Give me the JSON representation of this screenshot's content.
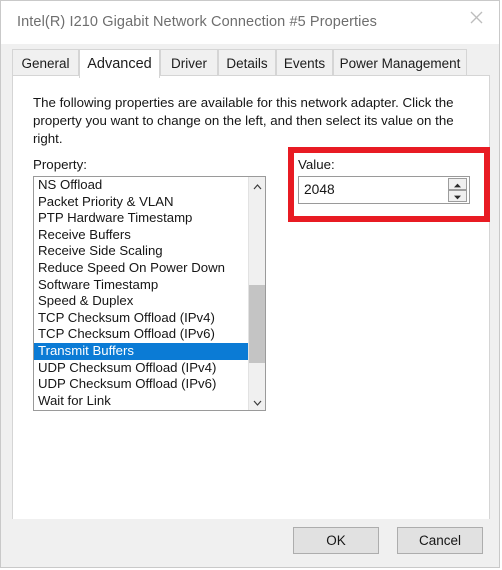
{
  "window": {
    "title": "Intel(R) I210 Gigabit Network Connection #5 Properties",
    "close_icon": "close-icon"
  },
  "tabs": [
    {
      "label": "General",
      "selected": false
    },
    {
      "label": "Advanced",
      "selected": true
    },
    {
      "label": "Driver",
      "selected": false
    },
    {
      "label": "Details",
      "selected": false
    },
    {
      "label": "Events",
      "selected": false
    },
    {
      "label": "Power Management",
      "selected": false
    }
  ],
  "advanced": {
    "description": "The following properties are available for this network adapter. Click the property you want to change on the left, and then select its value on the right.",
    "property_label": "Property:",
    "properties": [
      {
        "label": "NS Offload",
        "selected": false
      },
      {
        "label": "Packet Priority & VLAN",
        "selected": false
      },
      {
        "label": "PTP Hardware Timestamp",
        "selected": false
      },
      {
        "label": "Receive Buffers",
        "selected": false
      },
      {
        "label": "Receive Side Scaling",
        "selected": false
      },
      {
        "label": "Reduce Speed On Power Down",
        "selected": false
      },
      {
        "label": "Software Timestamp",
        "selected": false
      },
      {
        "label": "Speed & Duplex",
        "selected": false
      },
      {
        "label": "TCP Checksum Offload (IPv4)",
        "selected": false
      },
      {
        "label": "TCP Checksum Offload (IPv6)",
        "selected": false
      },
      {
        "label": "Transmit Buffers",
        "selected": true
      },
      {
        "label": "UDP Checksum Offload (IPv4)",
        "selected": false
      },
      {
        "label": "UDP Checksum Offload (IPv6)",
        "selected": false
      },
      {
        "label": "Wait for Link",
        "selected": false
      }
    ],
    "value_label": "Value:",
    "value": "2048",
    "scrollbar": {
      "up_icon": "chevron-up-icon",
      "down_icon": "chevron-down-icon"
    },
    "spinner": {
      "up_icon": "spinner-up-icon",
      "down_icon": "spinner-down-icon"
    }
  },
  "annotation": {
    "color": "#e81b23",
    "target": "value-field"
  },
  "footer": {
    "ok_label": "OK",
    "cancel_label": "Cancel"
  },
  "colors": {
    "selection": "#0b7bd5",
    "dialog_bg": "#f0f0f0",
    "page_bg": "#ffffff"
  }
}
